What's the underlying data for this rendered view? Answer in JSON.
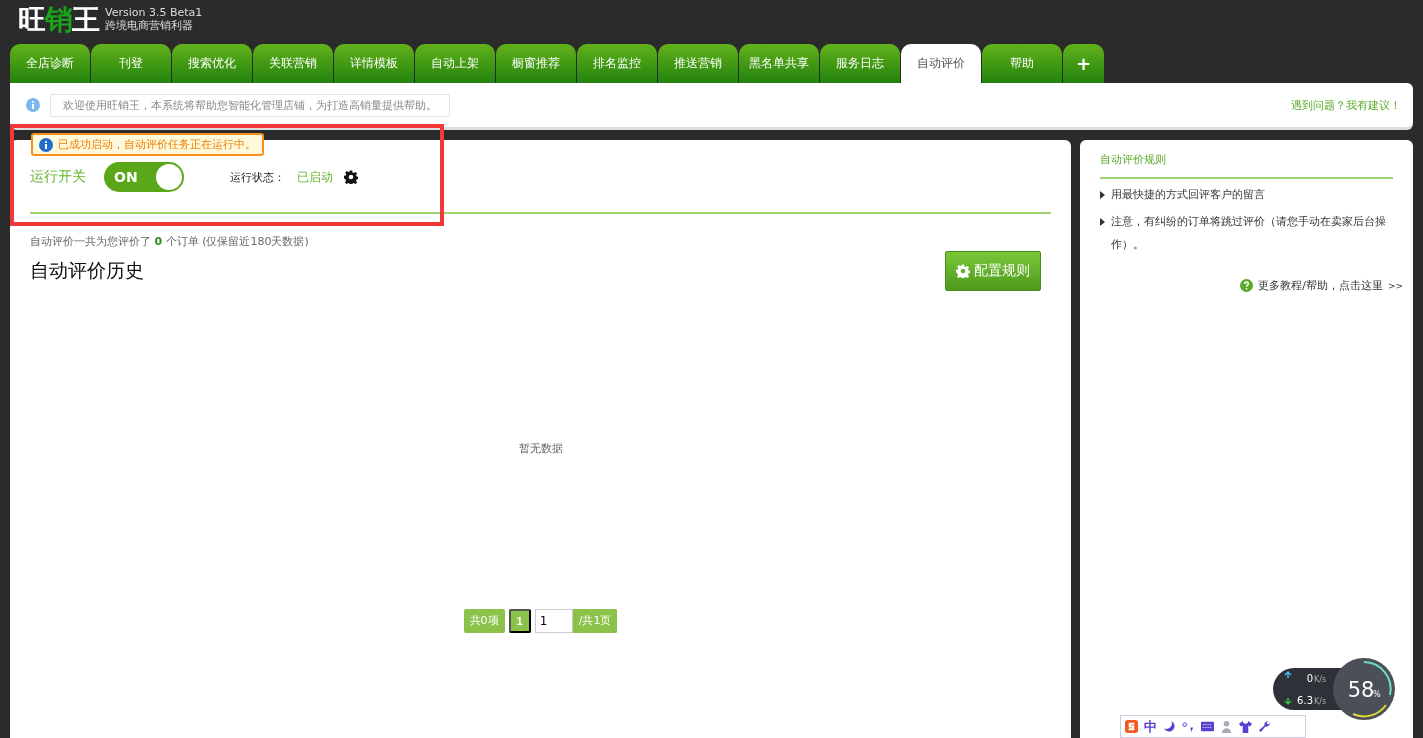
{
  "header": {
    "logo": [
      {
        "text": "旺",
        "highlight": false
      },
      {
        "text": "销",
        "highlight": true
      },
      {
        "text": "王",
        "highlight": false
      }
    ],
    "version": "Version 3.5 Beta1",
    "tagline": "跨境电商营销利器"
  },
  "tabs": [
    {
      "label": "全店诊断",
      "selected": false
    },
    {
      "label": "刊登",
      "selected": false
    },
    {
      "label": "搜索优化",
      "selected": false
    },
    {
      "label": "关联营销",
      "selected": false
    },
    {
      "label": "详情模板",
      "selected": false
    },
    {
      "label": "自动上架",
      "selected": false
    },
    {
      "label": "橱窗推荐",
      "selected": false
    },
    {
      "label": "排名监控",
      "selected": false
    },
    {
      "label": "推送营销",
      "selected": false
    },
    {
      "label": "黑名单共享",
      "selected": false
    },
    {
      "label": "服务日志",
      "selected": false
    },
    {
      "label": "自动评价",
      "selected": true
    },
    {
      "label": "帮助",
      "selected": false
    },
    {
      "label": "+",
      "selected": false
    }
  ],
  "notice": {
    "text": "欢迎使用旺销王，本系统将帮助您智能化管理店铺，为打造高销量提供帮助。",
    "link": "遇到问题？我有建议！"
  },
  "main": {
    "tooltip": "已成功启动，自动评价任务正在运行中。",
    "switch_label": "运行开关",
    "switch": {
      "on": true,
      "text": "ON"
    },
    "status_label": "运行状态：",
    "status_value": "已启动",
    "summary": "自动评价一共为您评价了 **0** 个订单 (仅保留近180天数据)",
    "title": "自动评价历史",
    "config_button": "配置规则",
    "empty": "暂无数据",
    "pagination": {
      "total": "共0项",
      "page": "1",
      "input": "1",
      "pages": "/共1页"
    }
  },
  "rules": {
    "title": "自动评价规则",
    "items": [
      "用最快捷的方式回评客户的留言",
      "注意，有纠纷的订单将跳过评价（请您手动在卖家后台操作）。"
    ],
    "help_link": "更多教程/帮助，点击这里",
    "help_arrow": ">>"
  },
  "net_widget": {
    "up": "0",
    "up_unit": "K/s",
    "down": "6.3",
    "down_unit": "K/s",
    "percent": "58",
    "percent_sign": "%"
  },
  "ime": {
    "items": [
      "中"
    ]
  }
}
